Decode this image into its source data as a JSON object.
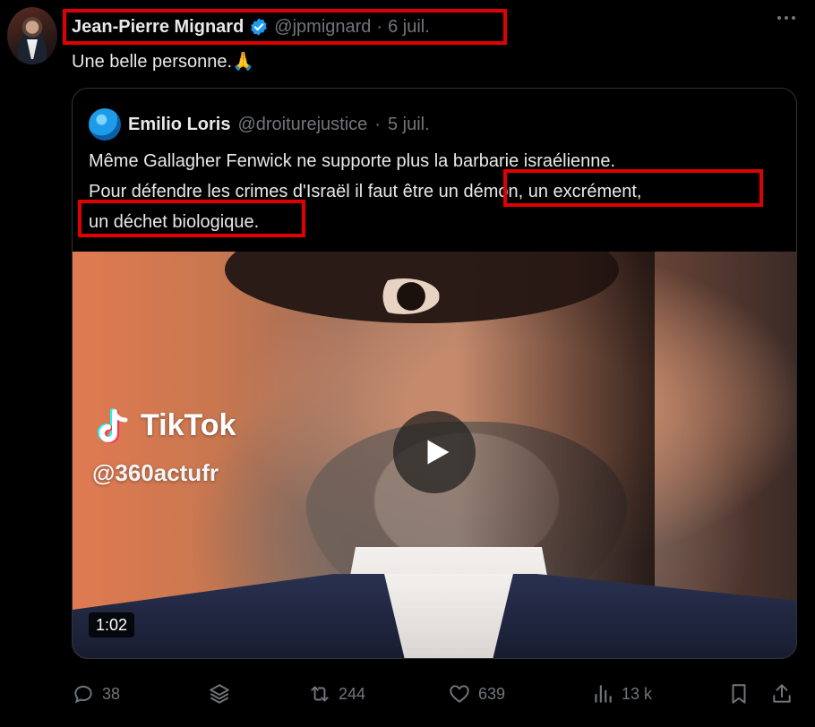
{
  "author": {
    "name": "Jean-Pierre Mignard",
    "handle": "@jpmignard",
    "separator": "·",
    "date": "6 juil."
  },
  "tweet_text": "Une belle personne.🙏",
  "quote": {
    "name": "Emilio Loris",
    "handle": "@droiturejustice",
    "separator": "·",
    "date": "5 juil.",
    "lines": [
      "Même Gallagher Fenwick ne supporte plus la barbarie israélienne.",
      "Pour défendre les crimes d'Israël il faut être un démon, un excrément,",
      "un déchet biologique."
    ]
  },
  "video": {
    "overlay_brand": "TikTok",
    "overlay_handle": "@360actufr",
    "duration": "1:02"
  },
  "actions": {
    "replies": "38",
    "reposts": "244",
    "likes": "639",
    "views": "13 k"
  },
  "colors": {
    "background": "#000000",
    "text": "#e7e9ea",
    "muted": "#71767b",
    "highlight_box": "#e10000",
    "verified": "#1d9bf0"
  }
}
